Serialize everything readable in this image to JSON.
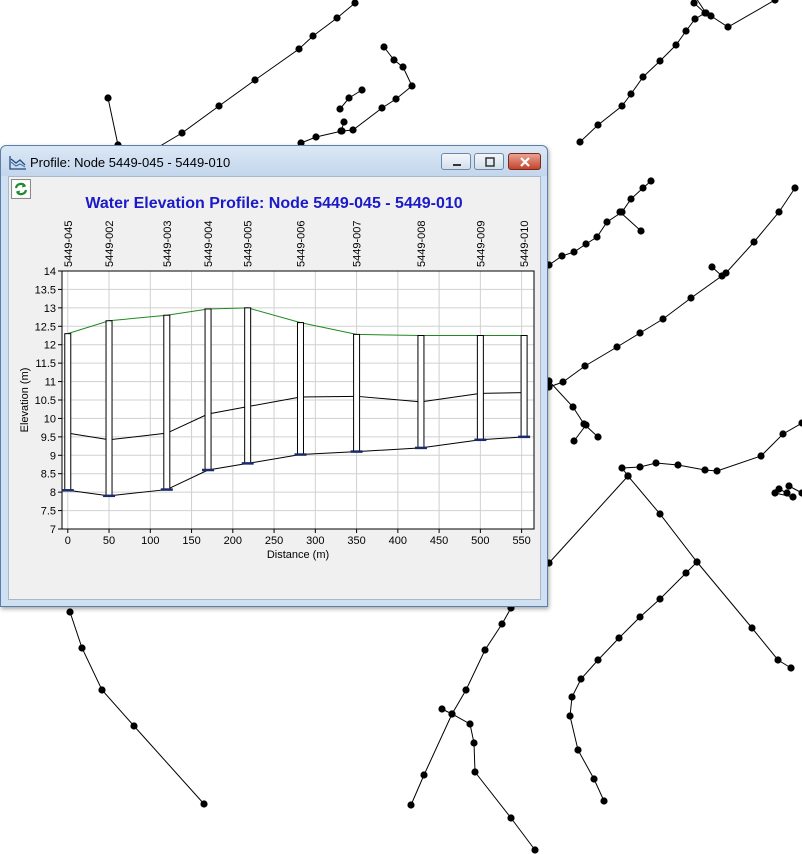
{
  "window": {
    "title": "Profile: Node 5449-045 - 5449-010",
    "icons": {
      "app": "profile-chart-icon",
      "refresh": "refresh-icon",
      "minimize": "minimize-icon",
      "maximize": "maximize-icon",
      "close": "close-icon"
    }
  },
  "chart_data": {
    "type": "line",
    "title": "Water Elevation Profile: Node 5449-045 - 5449-010",
    "xlabel": "Distance (m)",
    "ylabel": "Elevation (m)",
    "xlim": [
      -7,
      565
    ],
    "ylim": [
      7,
      14
    ],
    "xticks": [
      "0",
      "50",
      "100",
      "150",
      "200",
      "250",
      "300",
      "350",
      "400",
      "450",
      "500",
      "550"
    ],
    "yticks": [
      "7",
      "7.5",
      "8",
      "8.5",
      "9",
      "9.5",
      "10",
      "10.5",
      "11",
      "11.5",
      "12",
      "12.5",
      "13",
      "13.5",
      "14"
    ],
    "grid": true,
    "colors": {
      "hgl": "#1f8a1f",
      "pipe": "#000000",
      "title": "#1a1ac8"
    },
    "nodes": [
      {
        "name": "5449-045",
        "x": 0,
        "ground": 12.3,
        "invert": 8.05
      },
      {
        "name": "5449-002",
        "x": 50,
        "ground": 12.65,
        "invert": 7.9
      },
      {
        "name": "5449-003",
        "x": 120,
        "ground": 12.8,
        "invert": 8.07
      },
      {
        "name": "5449-004",
        "x": 170,
        "ground": 12.97,
        "invert": 8.6
      },
      {
        "name": "5449-005",
        "x": 218,
        "ground": 13.0,
        "invert": 8.78
      },
      {
        "name": "5449-006",
        "x": 282,
        "ground": 12.6,
        "invert": 9.02
      },
      {
        "name": "5449-007",
        "x": 350,
        "ground": 12.28,
        "invert": 9.1
      },
      {
        "name": "5449-008",
        "x": 428,
        "ground": 12.25,
        "invert": 9.2
      },
      {
        "name": "5449-009",
        "x": 500,
        "ground": 12.25,
        "invert": 9.42
      },
      {
        "name": "5449-010",
        "x": 553,
        "ground": 12.25,
        "invert": 9.5
      }
    ],
    "series": [
      {
        "values": [
          12.3,
          12.65,
          12.8,
          12.97,
          13.0,
          12.6,
          12.28,
          12.25,
          12.25,
          12.25
        ]
      },
      {
        "values": [
          9.6,
          9.42,
          9.6,
          10.12,
          10.32,
          10.58,
          10.6,
          10.45,
          10.68,
          10.7
        ]
      },
      {
        "values": [
          8.05,
          7.9,
          8.07,
          8.6,
          8.78,
          9.02,
          9.1,
          9.2,
          9.42,
          9.5
        ]
      }
    ]
  }
}
